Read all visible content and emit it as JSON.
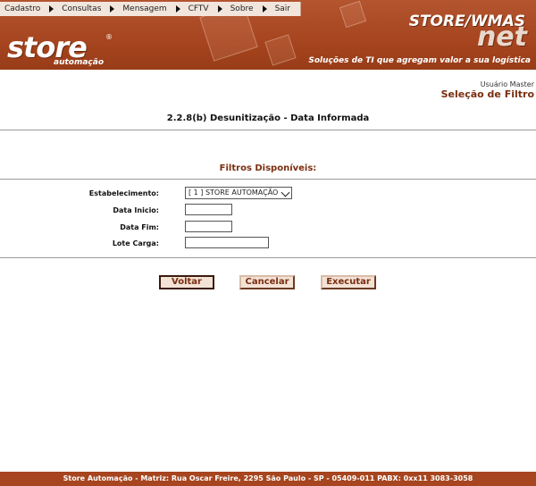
{
  "menu": [
    {
      "label": "Cadastro"
    },
    {
      "label": "Consultas"
    },
    {
      "label": "Mensagem"
    },
    {
      "label": "CFTV"
    },
    {
      "label": "Sobre"
    },
    {
      "label": "Sair"
    }
  ],
  "branding": {
    "logo": "store",
    "logo_sub": "automação",
    "product": "STORE/WMAS",
    "product_suffix": "net",
    "tagline": "Soluções de TI que agregam valor a sua logística"
  },
  "user": {
    "name": "Usuário Master"
  },
  "screen_title": "Seleção de Filtro",
  "page_title": "2.2.8(b) Desunitização - Data Informada",
  "filters_title": "Filtros Disponíveis:",
  "form": {
    "estabelecimento": {
      "label": "Estabelecimento:",
      "value": "[ 1 ] STORE AUTOMAÇÃO"
    },
    "data_inicio": {
      "label": "Data Inicio:",
      "value": ""
    },
    "data_fim": {
      "label": "Data Fim:",
      "value": ""
    },
    "lote_carga": {
      "label": "Lote Carga:",
      "value": ""
    }
  },
  "buttons": {
    "voltar": "Voltar",
    "cancelar": "Cancelar",
    "executar": "Executar"
  },
  "footer": "Store Automação - Matriz: Rua Oscar Freire, 2295 São Paulo - SP - 05409-011 PABX: 0xx11 3083-3058",
  "colors": {
    "brand": "#a6451f",
    "accent_text": "#7a2e10"
  }
}
